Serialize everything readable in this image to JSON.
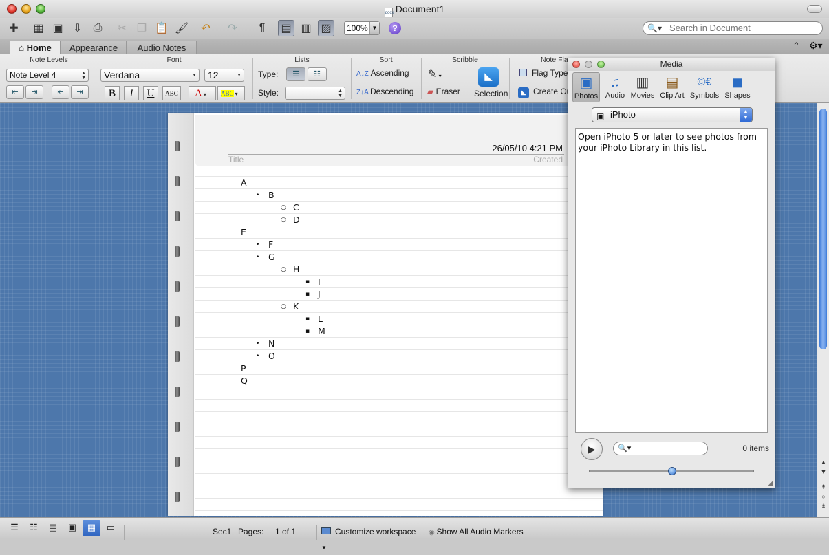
{
  "window": {
    "title": "Document1"
  },
  "toolbar": {
    "zoom": "100%",
    "search_placeholder": "Search in Document"
  },
  "ribbon_tabs": [
    {
      "label": "Home"
    },
    {
      "label": "Appearance"
    },
    {
      "label": "Audio Notes"
    }
  ],
  "ribbon": {
    "groups": {
      "note_levels": "Note Levels",
      "font": "Font",
      "lists": "Lists",
      "sort": "Sort",
      "scribble": "Scribble",
      "note_flags": "Note Flags"
    },
    "note_level_value": "Note Level 4",
    "font_name": "Verdana",
    "font_size": "12",
    "lists_type_label": "Type:",
    "lists_style_label": "Style:",
    "sort_ascending": "Ascending",
    "sort_descending": "Descending",
    "eraser": "Eraser",
    "selection": "Selection",
    "flag_type": "Flag Type",
    "create_outlook": "Create Ou",
    "bold": "B",
    "italic": "I",
    "underline": "U",
    "strike": "ABC"
  },
  "document": {
    "date": "26/05/10 4:21 PM",
    "title_placeholder": "Title",
    "created_label": "Created",
    "outline": [
      {
        "text": "A",
        "level": 0
      },
      {
        "text": "B",
        "level": 1
      },
      {
        "text": "C",
        "level": 2
      },
      {
        "text": "D",
        "level": 2
      },
      {
        "text": "E",
        "level": 0
      },
      {
        "text": "F",
        "level": 1
      },
      {
        "text": "G",
        "level": 1
      },
      {
        "text": "H",
        "level": 2
      },
      {
        "text": "I",
        "level": 3
      },
      {
        "text": "J",
        "level": 3
      },
      {
        "text": "K",
        "level": 2
      },
      {
        "text": "L",
        "level": 3
      },
      {
        "text": "M",
        "level": 3
      },
      {
        "text": "N",
        "level": 1
      },
      {
        "text": "O",
        "level": 1
      },
      {
        "text": "P",
        "level": 0
      },
      {
        "text": "Q",
        "level": 0
      }
    ]
  },
  "media": {
    "title": "Media",
    "tabs": [
      {
        "label": "Photos",
        "icon": "photos-icon"
      },
      {
        "label": "Audio",
        "icon": "audio-icon"
      },
      {
        "label": "Movies",
        "icon": "movies-icon"
      },
      {
        "label": "Clip Art",
        "icon": "clip-art-icon"
      },
      {
        "label": "Symbols",
        "icon": "symbols-icon"
      },
      {
        "label": "Shapes",
        "icon": "shapes-icon"
      }
    ],
    "source": "iPhoto",
    "message": "Open iPhoto 5 or later to see photos from your iPhoto Library in this list.",
    "items_count": "0 items"
  },
  "status": {
    "section": "Sec1",
    "pages_label": "Pages:",
    "pages_value": "1 of 1",
    "workspace": "Customize workspace",
    "audio_markers": "Show All Audio Markers"
  },
  "colors": {
    "desk": "#4d77ab",
    "accent": "#2e64c0"
  }
}
